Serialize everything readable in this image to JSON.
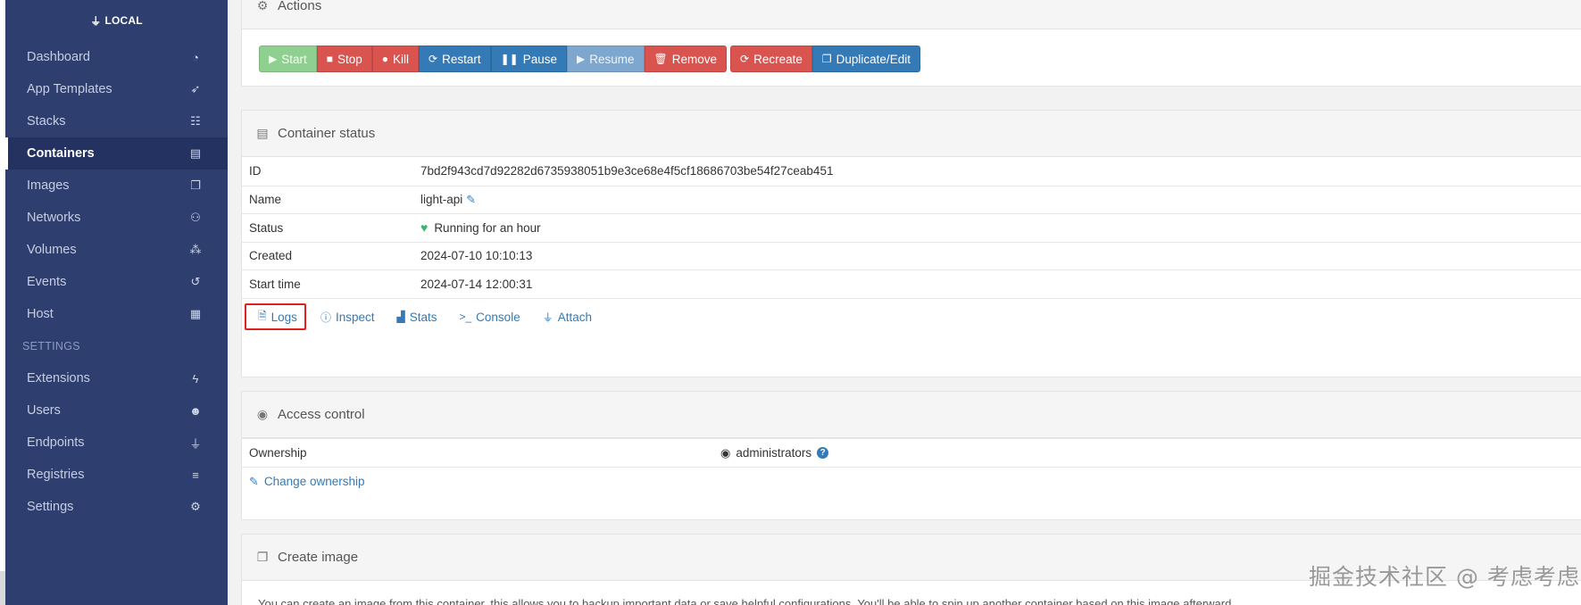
{
  "sidebar": {
    "endpoint": "LOCAL",
    "items": [
      {
        "label": "Dashboard",
        "icon": "dashboard-icon",
        "glyph": "◔"
      },
      {
        "label": "App Templates",
        "icon": "rocket-icon",
        "glyph": "➶"
      },
      {
        "label": "Stacks",
        "icon": "th-list-icon",
        "glyph": "☷"
      },
      {
        "label": "Containers",
        "icon": "server-icon",
        "glyph": "▤",
        "active": true
      },
      {
        "label": "Images",
        "icon": "clone-icon",
        "glyph": "❐"
      },
      {
        "label": "Networks",
        "icon": "sitemap-icon",
        "glyph": "⚇"
      },
      {
        "label": "Volumes",
        "icon": "cubes-icon",
        "glyph": "⁂"
      },
      {
        "label": "Events",
        "icon": "history-icon",
        "glyph": "↺"
      },
      {
        "label": "Host",
        "icon": "th-icon",
        "glyph": "▦"
      }
    ],
    "settings_header": "SETTINGS",
    "settings_items": [
      {
        "label": "Extensions",
        "icon": "bolt-icon",
        "glyph": "ϟ"
      },
      {
        "label": "Users",
        "icon": "users-icon",
        "glyph": "☻"
      },
      {
        "label": "Endpoints",
        "icon": "plug-icon",
        "glyph": "⏚"
      },
      {
        "label": "Registries",
        "icon": "database-icon",
        "glyph": "≡"
      },
      {
        "label": "Settings",
        "icon": "cogs-icon",
        "glyph": "⚙"
      }
    ]
  },
  "actions": {
    "title": "Actions",
    "buttons": {
      "start": "Start",
      "stop": "Stop",
      "kill": "Kill",
      "restart": "Restart",
      "pause": "Pause",
      "resume": "Resume",
      "remove": "Remove",
      "recreate": "Recreate",
      "duplicate": "Duplicate/Edit"
    }
  },
  "status": {
    "title": "Container status",
    "rows": [
      {
        "key": "ID",
        "value": "7bd2f943cd7d92282d6735938051b9e3ce68e4f5cf18686703be54f27ceab451"
      },
      {
        "key": "Name",
        "value": "light-api"
      },
      {
        "key": "Status",
        "value": "Running for an hour"
      },
      {
        "key": "Created",
        "value": "2024-07-10 10:10:13"
      },
      {
        "key": "Start time",
        "value": "2024-07-14 12:00:31"
      }
    ],
    "links": {
      "logs": "Logs",
      "inspect": "Inspect",
      "stats": "Stats",
      "console": "Console",
      "attach": "Attach"
    }
  },
  "access": {
    "title": "Access control",
    "ownership_label": "Ownership",
    "ownership_value": "administrators",
    "change_ownership": "Change ownership"
  },
  "create_image": {
    "title": "Create image",
    "description": "You can create an image from this container, this allows you to backup important data or save helpful configurations. You'll be able to spin up another container based on this image afterward."
  },
  "watermark": "掘金技术社区 @ 考虑考虑",
  "colors": {
    "sidebar_bg": "#2e3f6f",
    "primary": "#337ab7",
    "danger": "#d9534f",
    "success_disabled": "#8fcf8f",
    "highlight_box": "#e02020"
  }
}
